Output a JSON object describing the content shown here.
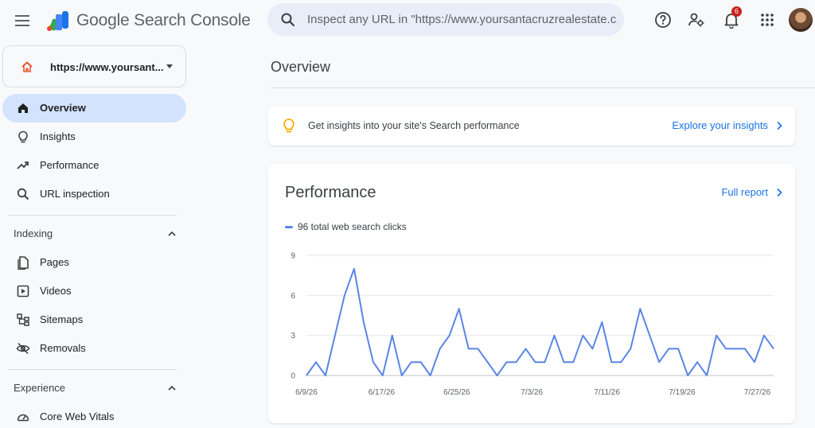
{
  "app": {
    "title": "Google Search Console"
  },
  "search": {
    "placeholder": "Inspect any URL in \"https://www.yoursantacruzrealestate.c..."
  },
  "header": {
    "notifications_count": "6",
    "icons": [
      "menu-icon",
      "search-icon",
      "help-icon",
      "manage-users-icon",
      "bell-icon",
      "apps-grid-icon",
      "avatar"
    ]
  },
  "property": {
    "label": "https://www.yoursant..."
  },
  "sidebar": {
    "items": [
      {
        "label": "Overview",
        "icon": "home-icon",
        "active": true
      },
      {
        "label": "Insights",
        "icon": "lightbulb-icon"
      },
      {
        "label": "Performance",
        "icon": "trending-up-icon"
      },
      {
        "label": "URL inspection",
        "icon": "search-icon"
      }
    ],
    "sections": [
      {
        "label": "Indexing",
        "items": [
          {
            "label": "Pages",
            "icon": "pages-icon"
          },
          {
            "label": "Videos",
            "icon": "video-icon"
          },
          {
            "label": "Sitemaps",
            "icon": "sitemap-icon"
          },
          {
            "label": "Removals",
            "icon": "eye-off-icon"
          }
        ]
      },
      {
        "label": "Experience",
        "items": [
          {
            "label": "Core Web Vitals",
            "icon": "speedometer-icon"
          }
        ]
      }
    ]
  },
  "main": {
    "title": "Overview",
    "insight": {
      "text": "Get insights into your site's Search performance",
      "link": "Explore your insights"
    },
    "performance": {
      "title": "Performance",
      "link": "Full report"
    }
  },
  "colors": {
    "accent": "#1a73e8",
    "series": "#5a85e6",
    "active_nav": "#d3e3fd",
    "badge": "#c5221f"
  },
  "chart_data": {
    "type": "line",
    "series": [
      {
        "name": "96 total web search clicks",
        "values": [
          0,
          1,
          0,
          3,
          6,
          8,
          4,
          1,
          0,
          3,
          0,
          1,
          1,
          0,
          2,
          3,
          5,
          2,
          2,
          1,
          0,
          1,
          1,
          2,
          1,
          1,
          3,
          1,
          1,
          3,
          2,
          4,
          1,
          1,
          2,
          5,
          3,
          1,
          2,
          2,
          0,
          1,
          0,
          3,
          2,
          2,
          2,
          1,
          3,
          2
        ]
      }
    ],
    "x_tick_labels": [
      "6/9/26",
      "6/17/26",
      "6/25/26",
      "7/3/26",
      "7/11/26",
      "7/19/26",
      "7/27/26"
    ],
    "y_ticks": [
      0,
      3,
      6,
      9
    ],
    "ylim": [
      0,
      9
    ],
    "grid": true
  }
}
